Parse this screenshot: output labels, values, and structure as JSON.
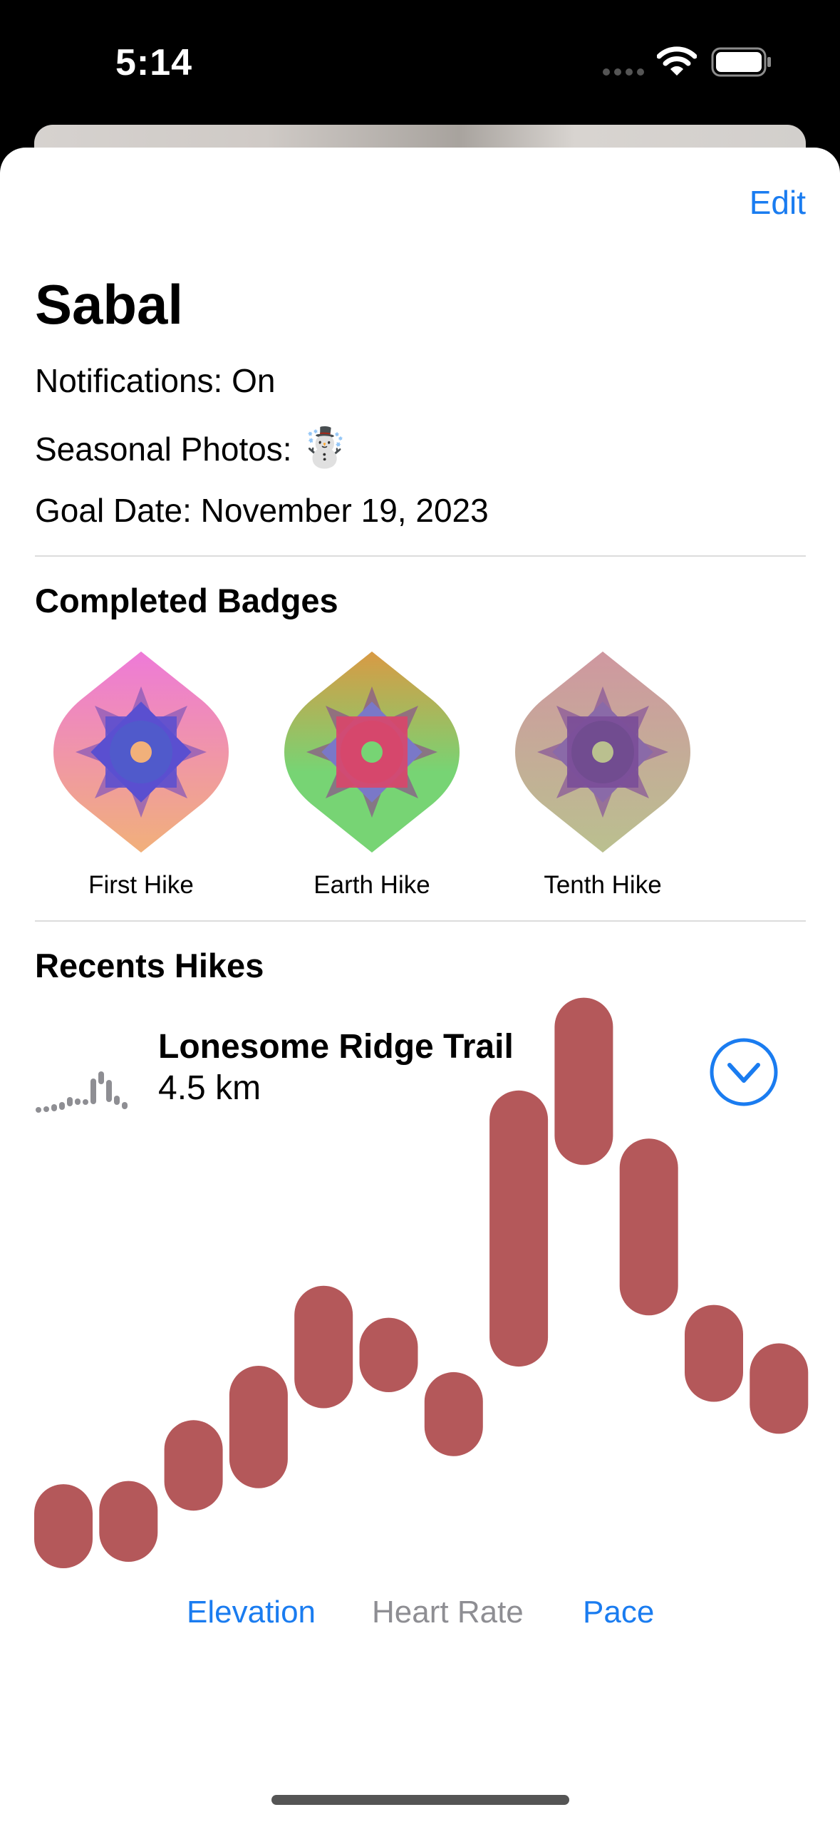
{
  "status_bar": {
    "time": "5:14"
  },
  "toolbar": {
    "edit_label": "Edit"
  },
  "profile": {
    "name": "Sabal",
    "notifications_label": "Notifications: On",
    "seasonal_label": "Seasonal Photos:",
    "seasonal_emoji": "☃️",
    "goal_label": "Goal Date: November 19, 2023"
  },
  "badges": {
    "title": "Completed Badges",
    "items": [
      {
        "label": "First Hike",
        "top_color": "#ee7ad8",
        "bottom_color": "#f1b07a",
        "center_color": "#5a4fd0"
      },
      {
        "label": "Earth Hike",
        "top_color": "#d99a44",
        "bottom_color": "#77d474",
        "center_color": "#d9466a"
      },
      {
        "label": "Tenth Hike",
        "top_color": "#cf97a0",
        "bottom_color": "#bac08f",
        "center_color": "#7a4e98"
      }
    ]
  },
  "recent": {
    "title": "Recents Hikes",
    "hike_name": "Lonesome Ridge Trail",
    "hike_distance": "4.5 km"
  },
  "chart_tabs": {
    "elevation": "Elevation",
    "heart_rate": "Heart Rate",
    "pace": "Pace"
  },
  "colors": {
    "accent": "#1a7cf0",
    "bar": "#b4585a"
  },
  "chart_data": {
    "type": "bar",
    "subtype": "range",
    "selected_metric": "Heart Rate",
    "ranges": [
      {
        "low": 0,
        "high": 8
      },
      {
        "low": 2,
        "high": 9
      },
      {
        "low": 18,
        "high": 28
      },
      {
        "low": 25,
        "high": 45
      },
      {
        "low": 50,
        "high": 70
      },
      {
        "low": 55,
        "high": 60
      },
      {
        "low": 35,
        "high": 43
      },
      {
        "low": 63,
        "high": 131
      },
      {
        "low": 126,
        "high": 160
      },
      {
        "low": 79,
        "high": 116
      },
      {
        "low": 52,
        "high": 64
      },
      {
        "low": 42,
        "high": 52
      }
    ]
  }
}
